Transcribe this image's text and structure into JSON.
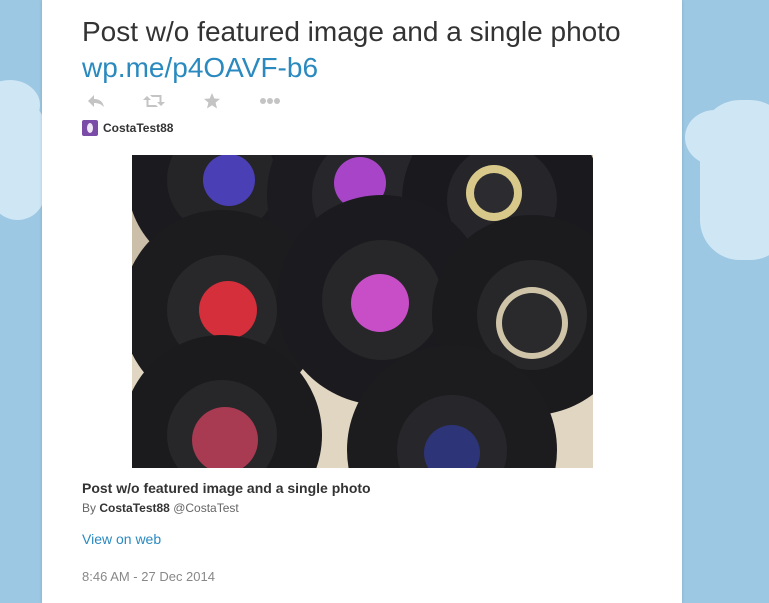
{
  "tweet": {
    "title": "Post w/o featured image and a single photo",
    "link_text": "wp.me/p4OAVF-b6",
    "author_name": "CostaTest88",
    "actions": {
      "reply_icon": "reply-icon",
      "retweet_icon": "retweet-icon",
      "favorite_icon": "star-icon",
      "more_icon": "more-icon"
    },
    "card": {
      "title": "Post w/o featured image and a single photo",
      "by_prefix": "By",
      "by_name": "CostaTest88",
      "by_handle": "@CostaTest",
      "view_on_web": "View on web"
    },
    "timestamp": "8:46 AM - 27 Dec 2014"
  },
  "colors": {
    "link": "#2a8abf",
    "avatar": "#7b4ba8",
    "background": "#9cc8e3"
  }
}
